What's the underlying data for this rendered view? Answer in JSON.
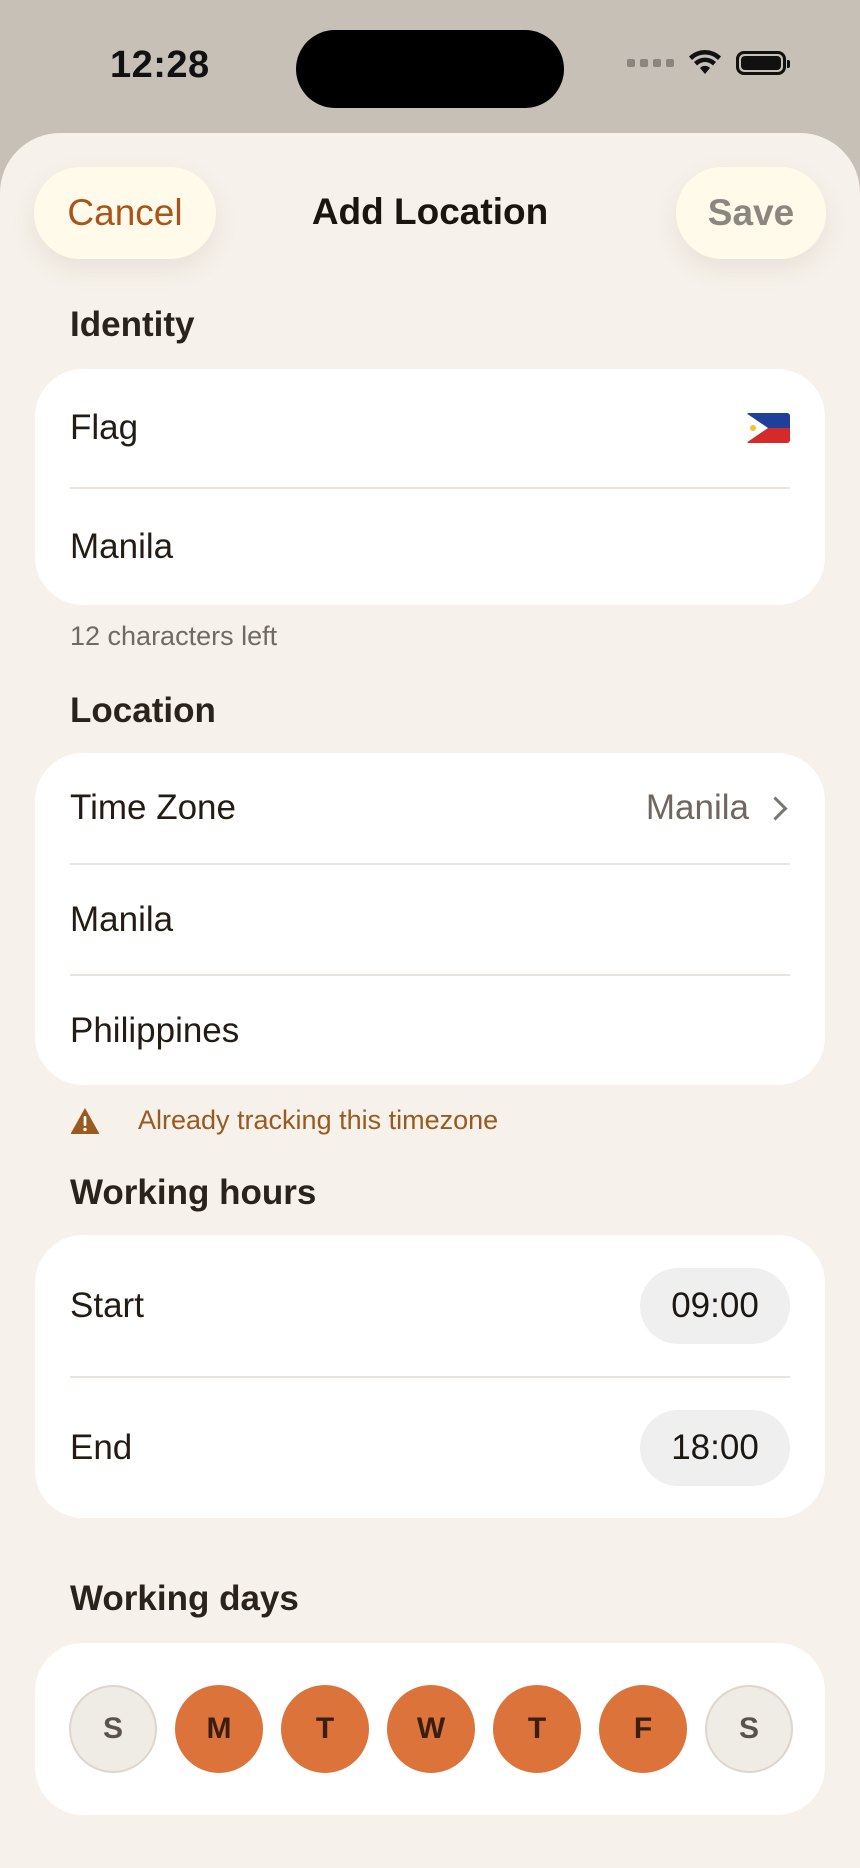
{
  "status_bar": {
    "time": "12:28",
    "icons": [
      "signal-icon",
      "wifi-icon",
      "battery-icon"
    ]
  },
  "nav": {
    "cancel_label": "Cancel",
    "title": "Add Location",
    "save_label": "Save"
  },
  "identity": {
    "header": "Identity",
    "flag_label": "Flag",
    "flag_value": "philippines-flag",
    "name_value": "Manila",
    "helper": "12 characters left"
  },
  "location": {
    "header": "Location",
    "timezone_label": "Time Zone",
    "timezone_value": "Manila",
    "city_value": "Manila",
    "country_value": "Philippines",
    "warning": "Already tracking this timezone"
  },
  "working_hours": {
    "header": "Working hours",
    "start_label": "Start",
    "start_value": "09:00",
    "end_label": "End",
    "end_value": "18:00"
  },
  "working_days": {
    "header": "Working days",
    "days": [
      {
        "label": "S",
        "selected": false
      },
      {
        "label": "M",
        "selected": true
      },
      {
        "label": "T",
        "selected": true
      },
      {
        "label": "W",
        "selected": true
      },
      {
        "label": "T",
        "selected": true
      },
      {
        "label": "F",
        "selected": true
      },
      {
        "label": "S",
        "selected": false
      }
    ]
  },
  "colors": {
    "accent": "#DB733B",
    "cancel_text": "#A9541C",
    "warning": "#9A5A1F",
    "sheet_bg": "#F6F1EA"
  }
}
